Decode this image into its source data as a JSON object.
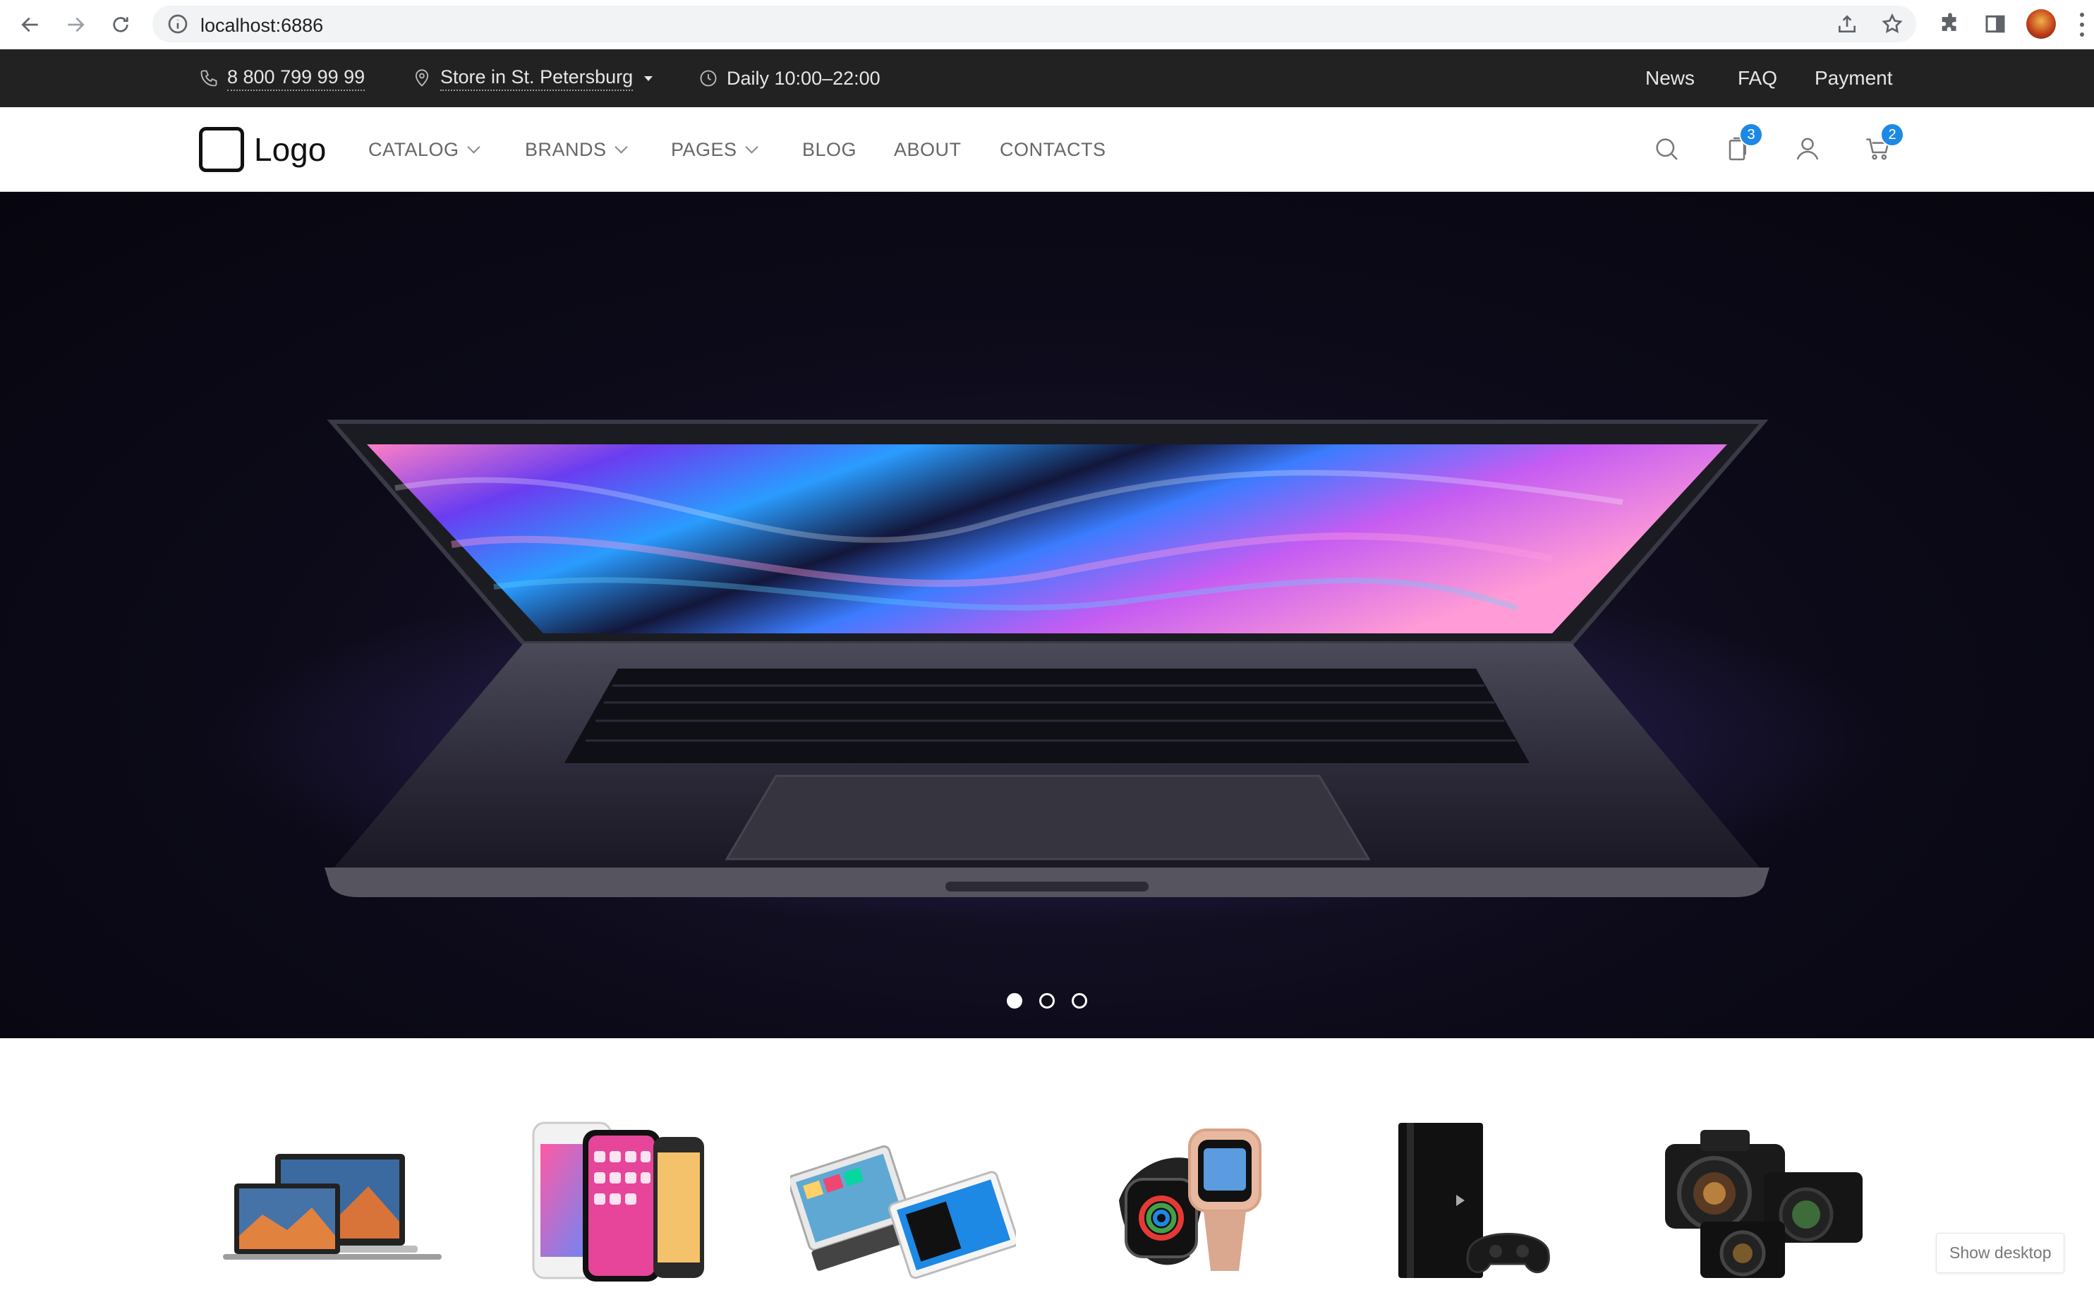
{
  "browser": {
    "url": "localhost:6886"
  },
  "topbar": {
    "phone": "8 800 799 99 99",
    "store": "Store in St. Petersburg",
    "hours": "Daily 10:00–22:00",
    "links": [
      "News",
      "FAQ",
      "Payment"
    ]
  },
  "header": {
    "logo": "Logo",
    "nav": [
      {
        "label": "CATALOG",
        "dropdown": true
      },
      {
        "label": "BRANDS",
        "dropdown": true
      },
      {
        "label": "PAGES",
        "dropdown": true
      },
      {
        "label": "BLOG",
        "dropdown": false
      },
      {
        "label": "ABOUT",
        "dropdown": false
      },
      {
        "label": "CONTACTS",
        "dropdown": false
      }
    ],
    "icons": {
      "compare_count": "3",
      "cart_count": "2"
    }
  },
  "hero": {
    "slides": 3,
    "active_slide": 1
  },
  "categories": [
    "laptops-icon",
    "phones-icon",
    "tablets-icon",
    "watches-icon",
    "consoles-icon",
    "cameras-icon"
  ],
  "floating": {
    "show_desktop": "Show desktop"
  },
  "colors": {
    "topbar_bg": "#222222",
    "badge": "#1e88e5",
    "hero_bg": "#0c0a18"
  }
}
